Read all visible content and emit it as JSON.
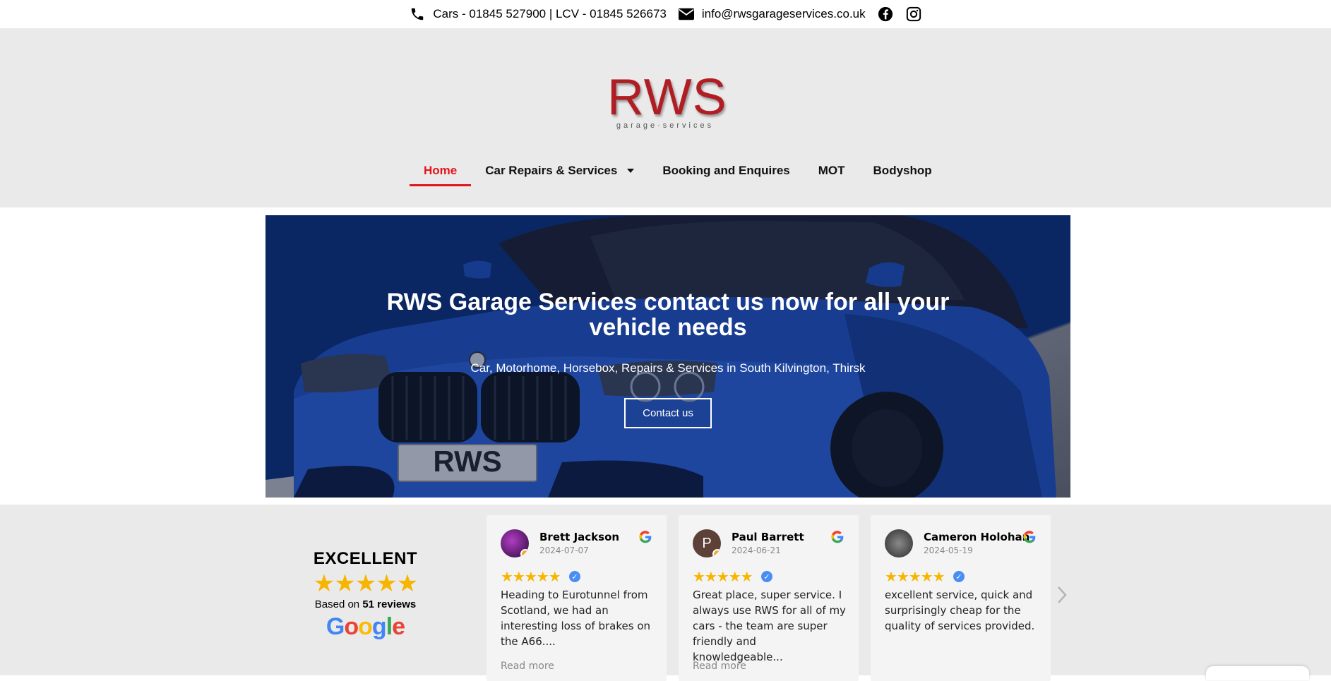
{
  "topbar": {
    "phone_text": "Cars - 01845 527900 | LCV - 01845 526673",
    "email_text": "info@rwsgarageservices.co.uk",
    "icons": [
      "phone-icon",
      "envelope-icon",
      "facebook-icon",
      "instagram-icon"
    ]
  },
  "logo": {
    "mark": "RWS",
    "sub": "garage·services",
    "color": "#b01e23"
  },
  "nav": {
    "items": [
      {
        "label": "Home",
        "active": true
      },
      {
        "label": "Car Repairs & Services",
        "has_dropdown": true
      },
      {
        "label": "Booking and Enquires"
      },
      {
        "label": "MOT"
      },
      {
        "label": "Bodyshop"
      }
    ],
    "active_color": "#e3141c"
  },
  "hero": {
    "title": "RWS Garage Services contact us now for all your vehicle needs",
    "subtitle": "Car, Motorhome, Horsebox, Repairs & Services in South Kilvington, Thirsk",
    "cta_label": "Contact us",
    "plate_text": "RWS"
  },
  "reviews_summary": {
    "rating_text": "EXCELLENT",
    "stars": "★★★★★",
    "based_on_prefix": "Based on",
    "review_count": "51 reviews",
    "provider": "Google"
  },
  "reviews": [
    {
      "name": "Brett Jackson",
      "date": "2024-07-07",
      "stars": "★★★★★",
      "text": "Heading to Eurotunnel from Scotland, we had an interesting loss of brakes on the A66....",
      "read_more": "Read more",
      "avatar_initial": ""
    },
    {
      "name": "Paul Barrett",
      "date": "2024-06-21",
      "stars": "★★★★★",
      "text": "Great place, super service. I always use RWS for all of my cars - the team are super friendly and knowledgeable...",
      "read_more": "Read more",
      "avatar_initial": "P"
    },
    {
      "name": "Cameron Holohan",
      "date": "2024-05-19",
      "stars": "★★★★★",
      "text": "excellent service, quick and surprisingly cheap for the quality of services provided.",
      "read_more": "",
      "avatar_initial": ""
    }
  ]
}
